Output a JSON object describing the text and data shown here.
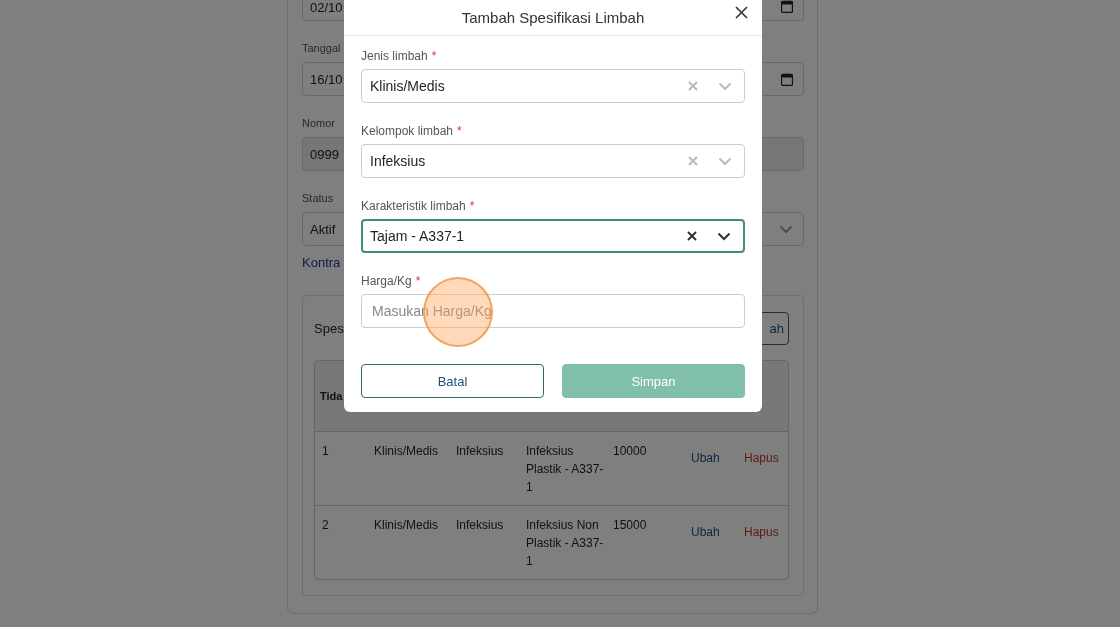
{
  "background_form": {
    "fields": [
      {
        "kind": "date",
        "value": "02/10"
      },
      {
        "kind": "date",
        "label": "Tanggal",
        "value": "16/10"
      },
      {
        "kind": "readonly",
        "label": "Nomor",
        "value": "0999"
      },
      {
        "kind": "select",
        "label": "Status",
        "value": "Aktif"
      }
    ],
    "link": "Kontra",
    "spec_card": {
      "title": "Spes",
      "button": "ah",
      "table": {
        "columns": [
          "Tida"
        ],
        "rows": [
          {
            "cells": [
              "1",
              "Klinis/Medis",
              "Infeksius",
              "Infeksius Plastik - A337-1",
              "10000"
            ],
            "actions": [
              {
                "label": "Ubah",
                "kind": "edit"
              },
              {
                "label": "Hapus",
                "kind": "delete"
              }
            ]
          },
          {
            "cells": [
              "2",
              "Klinis/Medis",
              "Infeksius",
              "Infeksius Non Plastik - A337-1",
              "15000"
            ],
            "actions": [
              {
                "label": "Ubah",
                "kind": "edit"
              },
              {
                "label": "Hapus",
                "kind": "delete"
              }
            ]
          }
        ]
      }
    }
  },
  "modal": {
    "title": "Tambah Spesifikasi Limbah",
    "fields": [
      {
        "kind": "select",
        "label": "Jenis limbah",
        "required_mark": "*",
        "value": "Klinis/Medis",
        "focused": false
      },
      {
        "kind": "select",
        "label": "Kelompok limbah",
        "required_mark": "*",
        "value": "Infeksius",
        "focused": false
      },
      {
        "kind": "select",
        "label": "Karakteristik limbah",
        "required_mark": "*",
        "value": "Tajam - A337-1",
        "focused": true
      },
      {
        "kind": "input",
        "label": "Harga/Kg",
        "required_mark": "*",
        "placeholder": "Masukan Harga/Kg"
      }
    ],
    "buttons": [
      {
        "label": "Batal",
        "kind": "secondary"
      },
      {
        "label": "Simpan",
        "kind": "primary"
      }
    ]
  }
}
